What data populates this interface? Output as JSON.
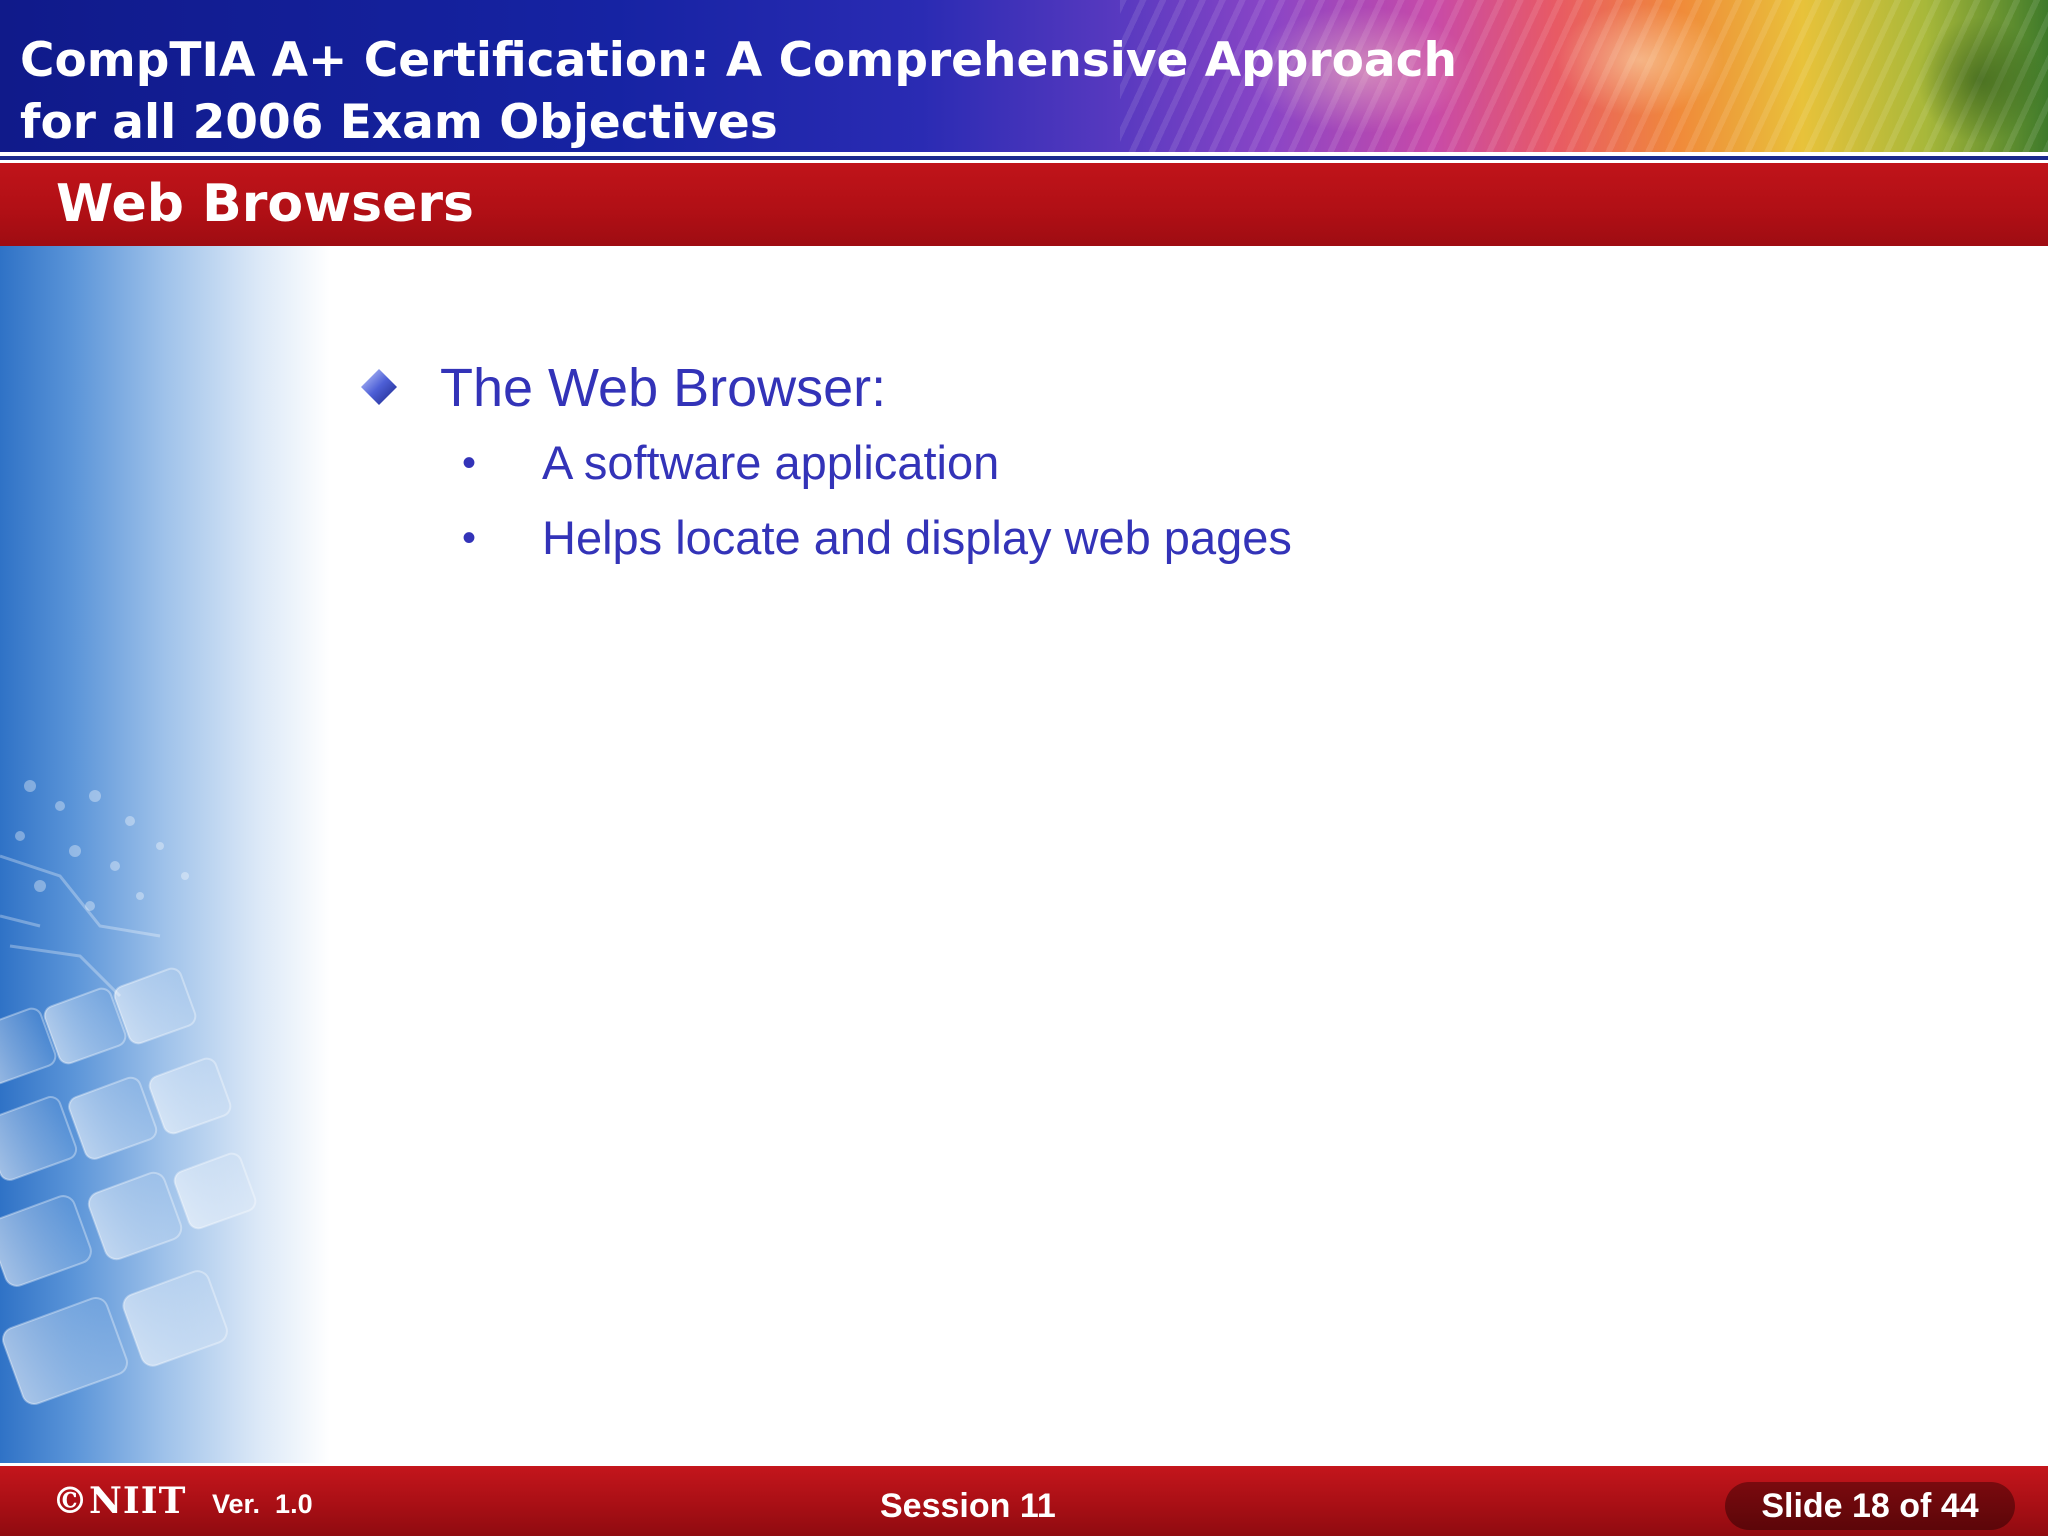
{
  "header": {
    "title_line1": "CompTIA A+ Certification: A Comprehensive Approach",
    "title_line2": "for all 2006 Exam Objectives"
  },
  "section": {
    "title": "Web Browsers"
  },
  "content": {
    "heading": "The Web Browser:",
    "bullets": [
      "A software application",
      "Helps locate and display web pages"
    ],
    "heading_icon": "diamond-bullet-icon",
    "bullet_glyph": "•"
  },
  "footer": {
    "logo": "©NIIT",
    "version": "Ver.  1.0",
    "session": "Session 11",
    "slide": "Slide 18 of 44"
  },
  "colors": {
    "header_blue": "#1623a3",
    "section_red": "#b00f15",
    "text_blue": "#3333b8",
    "footer_red": "#a90f15"
  }
}
